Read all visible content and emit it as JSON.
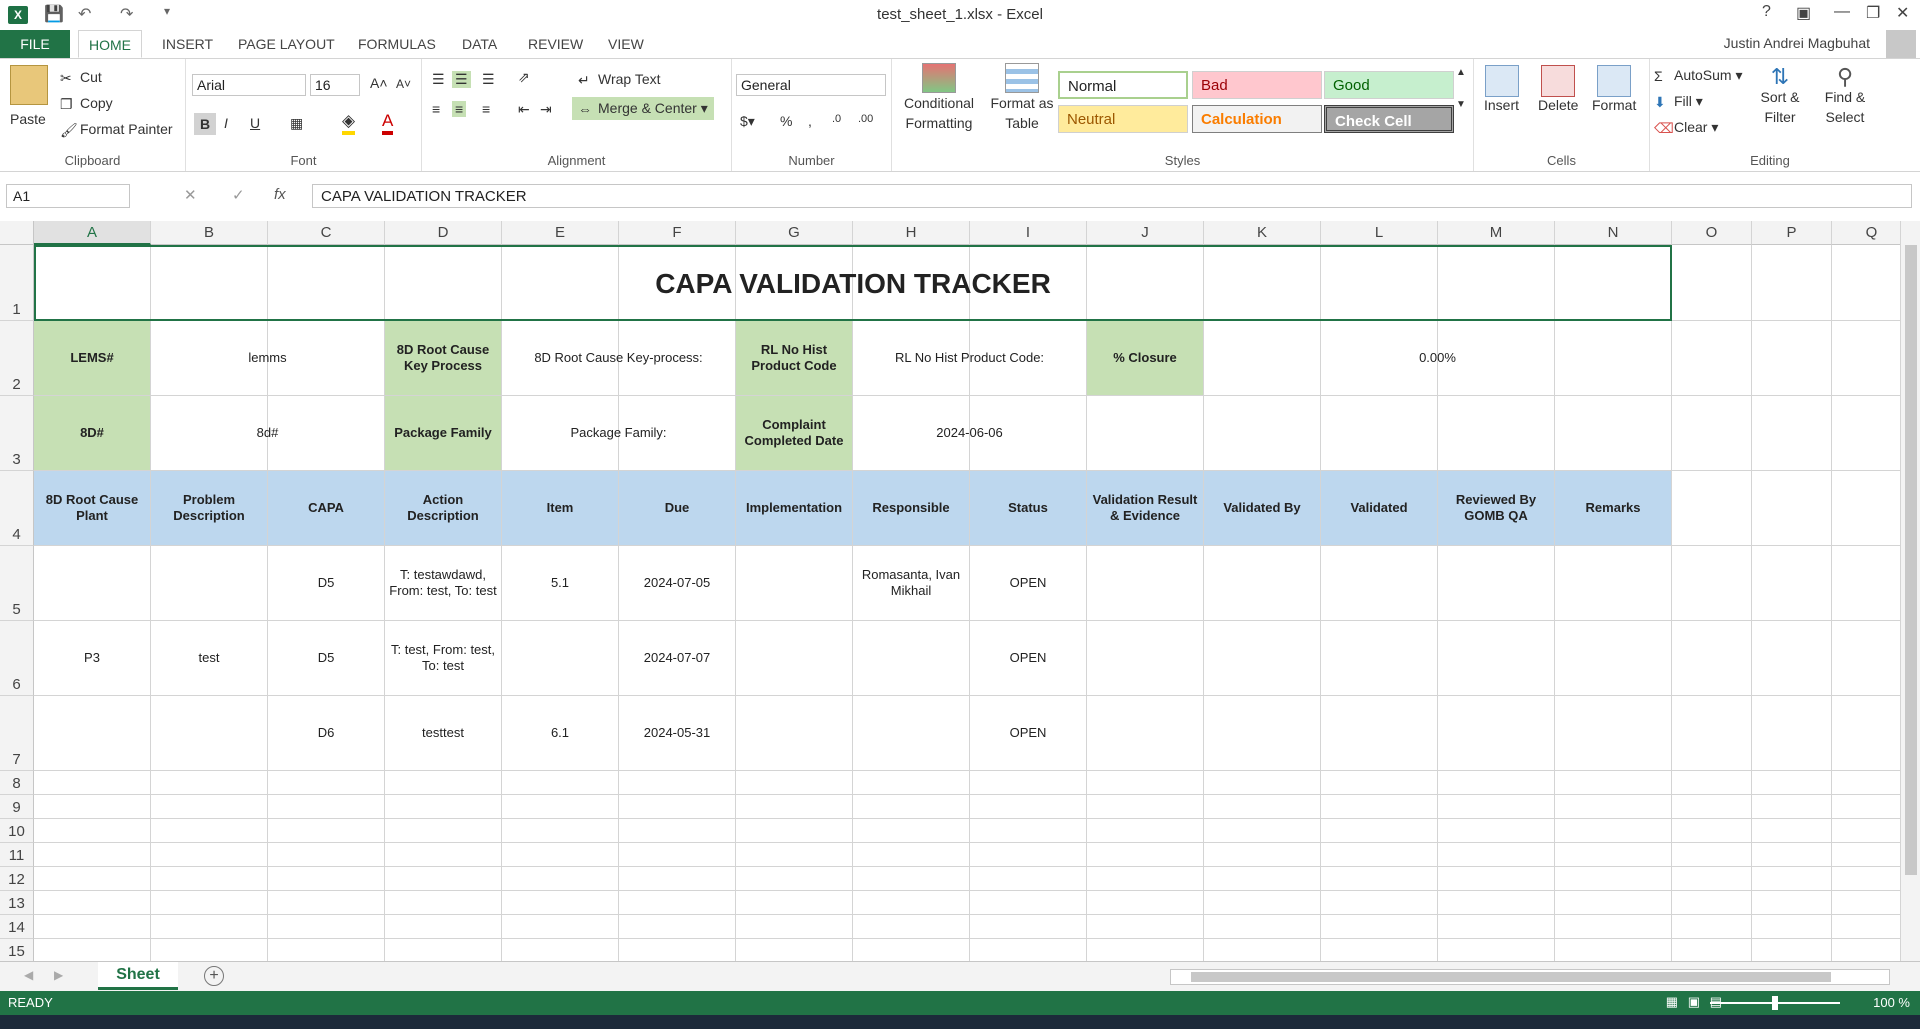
{
  "window": {
    "title": "test_sheet_1.xlsx - Excel",
    "user": "Justin Andrei Magbuhat"
  },
  "tabs": [
    "FILE",
    "HOME",
    "INSERT",
    "PAGE LAYOUT",
    "FORMULAS",
    "DATA",
    "REVIEW",
    "VIEW"
  ],
  "ribbon": {
    "clipboard": {
      "label": "Clipboard",
      "paste": "Paste",
      "cut": "Cut",
      "copy": "Copy",
      "format_painter": "Format Painter"
    },
    "font": {
      "label": "Font",
      "name": "Arial",
      "size": "16"
    },
    "alignment": {
      "label": "Alignment",
      "wrap": "Wrap Text",
      "merge": "Merge & Center"
    },
    "number": {
      "label": "Number",
      "format": "General"
    },
    "styles": {
      "label": "Styles",
      "cond": "Conditional Formatting",
      "table": "Format as Table",
      "boxes": [
        "Normal",
        "Bad",
        "Good",
        "Neutral",
        "Calculation",
        "Check Cell"
      ]
    },
    "cells": {
      "label": "Cells",
      "insert": "Insert",
      "delete": "Delete",
      "format": "Format"
    },
    "editing": {
      "label": "Editing",
      "autosum": "AutoSum",
      "fill": "Fill",
      "clear": "Clear",
      "sort": "Sort & Filter",
      "find": "Find & Select"
    }
  },
  "formula_bar": {
    "name_box": "A1",
    "fx": "fx",
    "content": "CAPA VALIDATION TRACKER"
  },
  "columns": [
    "A",
    "B",
    "C",
    "D",
    "E",
    "F",
    "G",
    "H",
    "I",
    "J",
    "K",
    "L",
    "M",
    "N",
    "O",
    "P",
    "Q"
  ],
  "rows": [
    "1",
    "2",
    "3",
    "4",
    "5",
    "6",
    "7",
    "8",
    "9",
    "10",
    "11",
    "12",
    "13",
    "14",
    "15"
  ],
  "sheet": {
    "title": "CAPA VALIDATION TRACKER",
    "row2": {
      "lems_label": "LEMS#",
      "lems_value": "lemms",
      "rc_label": "8D Root Cause Key Process",
      "rc_value": "8D Root Cause Key-process:",
      "rl_label": "RL No Hist Product Code",
      "rl_value": "RL No Hist Product Code:",
      "closure_label": "% Closure",
      "closure_value": "0.00%"
    },
    "row3": {
      "d8_label": "8D#",
      "d8_value": "8d#",
      "pkg_label": "Package Family",
      "pkg_value": "Package Family:",
      "cc_label": "Complaint Completed Date",
      "cc_value": "2024-06-06"
    },
    "headers": [
      "8D Root Cause Plant",
      "Problem Description",
      "CAPA",
      "Action Description",
      "Item",
      "Due",
      "Implementation",
      "Responsible",
      "Status",
      "Validation Result & Evidence",
      "Validated By",
      "Validated",
      "Reviewed By GOMB QA",
      "Remarks"
    ],
    "plant": "P3",
    "problem": "test",
    "records": [
      {
        "capa": "D5",
        "action": "T: testawdawd, From: test, To: test",
        "item": "5.1",
        "due": "2024-07-05",
        "responsible": "Romasanta, Ivan Mikhail",
        "status": "OPEN"
      },
      {
        "capa": "D5",
        "action": "T: test, From: test, To: test",
        "item": "",
        "due": "2024-07-07",
        "responsible": "",
        "status": "OPEN"
      },
      {
        "capa": "D6",
        "action": "testtest",
        "item": "6.1",
        "due": "2024-05-31",
        "responsible": "",
        "status": "OPEN"
      }
    ]
  },
  "sheet_tab": "Sheet",
  "status": {
    "ready": "READY",
    "zoom": "100 %"
  }
}
